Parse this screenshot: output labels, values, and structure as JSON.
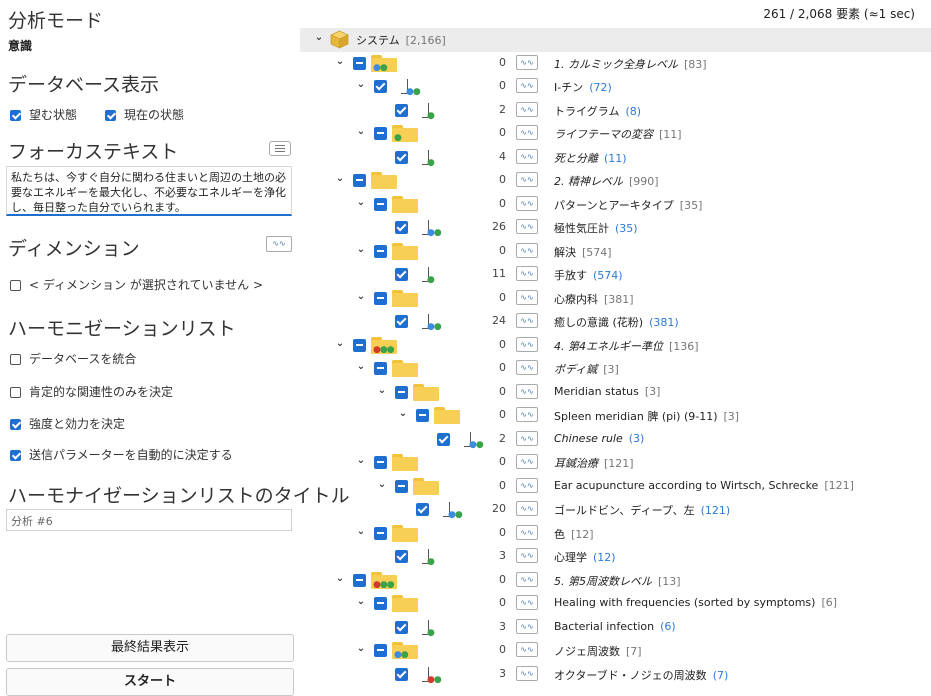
{
  "left": {
    "analysis_mode_heading": "分析モード",
    "analysis_mode_value": "意識",
    "db_display_heading": "データベース表示",
    "desired_state_label": "望む状態",
    "current_state_label": "現在の状態",
    "focus_text_heading": "フォーカステキスト",
    "focus_text_value": "私たちは、今すぐ自分に関わる住まいと周辺の土地の必要なエネルギーを最大化し、不必要なエネルギーを浄化し、毎日整った自分でいられます。",
    "dimension_heading": "ディメンション",
    "dimension_none_label": "< ディメンション が選択されていません >",
    "harmonization_list_heading": "ハーモニゼーションリスト",
    "options": [
      {
        "label": "データベースを統合",
        "checked": false
      },
      {
        "label": "肯定的な関連性のみを決定",
        "checked": false
      },
      {
        "label": "強度と効力を決定",
        "checked": true
      },
      {
        "label": "送信パラメーターを自動的に決定する",
        "checked": true
      }
    ],
    "list_title_heading": "ハーモナイゼーションリストのタイトル",
    "list_title_value": "分析 #6",
    "final_result_button": "最終結果表示",
    "start_button": "スタート"
  },
  "right": {
    "status": "261 / 2,068 要素 (≈1 sec)",
    "wave_icon_text": "∿∿",
    "rows": [
      {
        "indent": 0,
        "kind": "root",
        "toggle": "v",
        "label": "システム",
        "count": "[2,166]",
        "count_style": "b"
      },
      {
        "indent": 1,
        "kind": "folder",
        "toggle": "v",
        "check": "partial",
        "dots": [
          [
            "#3b8be0",
            "#3aa34a"
          ]
        ],
        "num": "0",
        "label": "1. カルミック全身レベル",
        "italic": true,
        "count": "[83]",
        "count_style": "b"
      },
      {
        "indent": 2,
        "kind": "doc",
        "toggle": "v",
        "check": "checked",
        "dots": [
          "#3b8be0",
          "#3aa34a"
        ],
        "num": "0",
        "label": "I-チン",
        "count": "(72)",
        "count_style": "l"
      },
      {
        "indent": 3,
        "kind": "doc",
        "check": "checked",
        "dots": [
          "#3aa34a"
        ],
        "num": "2",
        "label": "トライグラム",
        "count": "(8)",
        "count_style": "l"
      },
      {
        "indent": 2,
        "kind": "folder",
        "toggle": "v",
        "check": "partial",
        "dots": [
          "#3aa34a"
        ],
        "num": "0",
        "label": "ライフテーマの変容",
        "italic": true,
        "count": "[11]",
        "count_style": "b"
      },
      {
        "indent": 3,
        "kind": "doc",
        "check": "checked",
        "dots": [
          "#3aa34a"
        ],
        "num": "4",
        "label": "死と分離",
        "italic": true,
        "count": "(11)",
        "count_style": "l"
      },
      {
        "indent": 1,
        "kind": "folder",
        "toggle": "v",
        "check": "partial",
        "dots": [],
        "num": "0",
        "label": "2. 精神レベル",
        "italic": true,
        "count": "[990]",
        "count_style": "b"
      },
      {
        "indent": 2,
        "kind": "folder",
        "toggle": "v",
        "check": "partial",
        "dots": [],
        "num": "0",
        "label": "パターンとアーキタイプ",
        "count": "[35]",
        "count_style": "b"
      },
      {
        "indent": 3,
        "kind": "doc",
        "check": "checked",
        "dots": [
          "#3b8be0",
          "#3aa34a"
        ],
        "num": "26",
        "label": "極性気圧計",
        "count": "(35)",
        "count_style": "l"
      },
      {
        "indent": 2,
        "kind": "folder",
        "toggle": "v",
        "check": "partial",
        "dots": [],
        "num": "0",
        "label": "解決",
        "count": "[574]",
        "count_style": "b"
      },
      {
        "indent": 3,
        "kind": "doc",
        "check": "checked",
        "dots": [
          "#3aa34a"
        ],
        "num": "11",
        "label": "手放す",
        "count": "(574)",
        "count_style": "l"
      },
      {
        "indent": 2,
        "kind": "folder",
        "toggle": "v",
        "check": "partial",
        "dots": [],
        "num": "0",
        "label": "心療内科",
        "count": "[381]",
        "count_style": "b"
      },
      {
        "indent": 3,
        "kind": "doc",
        "check": "checked",
        "dots": [
          "#3b8be0",
          "#3aa34a"
        ],
        "num": "24",
        "label": "癒しの意識 (花粉)",
        "count": "(381)",
        "count_style": "l"
      },
      {
        "indent": 1,
        "kind": "folder",
        "toggle": "v",
        "check": "partial",
        "dots": [
          "#d23a2a",
          "#3aa34a",
          "#3aa34a"
        ],
        "num": "0",
        "label": "4. 第4エネルギー準位",
        "italic": true,
        "count": "[136]",
        "count_style": "b"
      },
      {
        "indent": 2,
        "kind": "folder",
        "toggle": "v",
        "check": "partial",
        "dots": [],
        "num": "0",
        "label": "ボディ鍼",
        "italic": true,
        "count": "[3]",
        "count_style": "b"
      },
      {
        "indent": 3,
        "kind": "folder",
        "toggle": "v",
        "check": "partial",
        "dots": [],
        "num": "0",
        "label": "Meridian status",
        "count": "[3]",
        "count_style": "b"
      },
      {
        "indent": 4,
        "kind": "folder",
        "toggle": "v",
        "check": "partial",
        "dots": [],
        "num": "0",
        "label": "Spleen meridian 脾 (pi) (9-11)",
        "count": "[3]",
        "count_style": "b"
      },
      {
        "indent": 5,
        "kind": "doc",
        "check": "checked",
        "dots": [
          "#3b8be0",
          "#3aa34a"
        ],
        "num": "2",
        "label": "Chinese rule",
        "italic": true,
        "count": "(3)",
        "count_style": "l"
      },
      {
        "indent": 2,
        "kind": "folder",
        "toggle": "v",
        "check": "partial",
        "dots": [],
        "num": "0",
        "label": "耳鍼治療",
        "italic": true,
        "count": "[121]",
        "count_style": "b"
      },
      {
        "indent": 3,
        "kind": "folder",
        "toggle": "v",
        "check": "partial",
        "dots": [],
        "num": "0",
        "label": "Ear acupuncture according to Wirtsch, Schrecke",
        "count": "[121]",
        "count_style": "b"
      },
      {
        "indent": 4,
        "kind": "doc",
        "check": "checked",
        "dots": [
          "#3b8be0",
          "#3aa34a"
        ],
        "num": "20",
        "label": "ゴールドビン、ディープ、左",
        "count": "(121)",
        "count_style": "l"
      },
      {
        "indent": 2,
        "kind": "folder",
        "toggle": "v",
        "check": "partial",
        "dots": [],
        "num": "0",
        "label": "色",
        "count": "[12]",
        "count_style": "b"
      },
      {
        "indent": 3,
        "kind": "doc",
        "check": "checked",
        "dots": [
          "#3aa34a"
        ],
        "num": "3",
        "label": "心理学",
        "count": "(12)",
        "count_style": "l"
      },
      {
        "indent": 1,
        "kind": "folder",
        "toggle": "v",
        "check": "partial",
        "dots": [
          "#d23a2a",
          "#3aa34a",
          "#3aa34a"
        ],
        "num": "0",
        "label": "5. 第5周波数レベル",
        "italic": true,
        "count": "[13]",
        "count_style": "b"
      },
      {
        "indent": 2,
        "kind": "folder",
        "toggle": "v",
        "check": "partial",
        "dots": [],
        "num": "0",
        "label": "Healing with frequencies (sorted by symptoms)",
        "count": "[6]",
        "count_style": "b"
      },
      {
        "indent": 3,
        "kind": "doc",
        "check": "checked",
        "dots": [
          "#3aa34a"
        ],
        "num": "3",
        "label": "Bacterial infection",
        "count": "(6)",
        "count_style": "l"
      },
      {
        "indent": 2,
        "kind": "folder",
        "toggle": "v",
        "check": "partial",
        "dots": [
          "#3b8be0",
          "#3aa34a"
        ],
        "num": "0",
        "label": "ノジェ周波数",
        "count": "[7]",
        "count_style": "b"
      },
      {
        "indent": 3,
        "kind": "doc",
        "check": "checked",
        "dots": [
          "#d23a2a",
          "#3aa34a"
        ],
        "num": "3",
        "label": "オクターブド・ノジェの周波数",
        "count": "(7)",
        "count_style": "l"
      }
    ]
  }
}
